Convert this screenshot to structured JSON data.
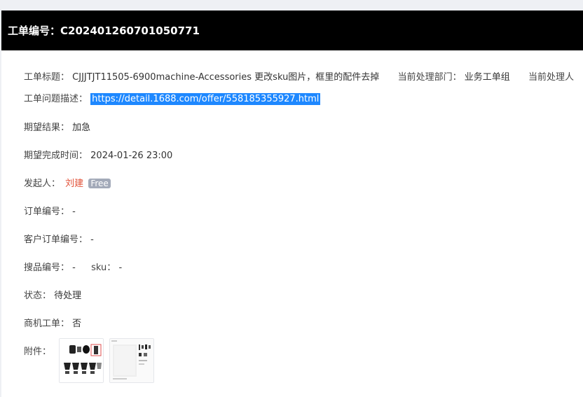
{
  "header": {
    "title": "工单编号：C202401260701050771"
  },
  "fields": {
    "title_label": "工单标题：",
    "title_value": "CJJJTJT11505-6900machine-Accessories  更改sku图片，框里的配件去掉",
    "dept_label": "当前处理部门：",
    "dept_value": "业务工单组",
    "handler_label": "当前处理人",
    "desc_label": "工单问题描述：",
    "desc_link": "https://detail.1688.com/offer/558185355927.html",
    "expect_label": "期望结果：",
    "expect_value": "加急",
    "due_label": "期望完成时间：",
    "due_value": "2024-01-26 23:00",
    "initiator_label": "发起人：",
    "initiator_name": "刘建",
    "initiator_badge": "Free",
    "order_label": "订单编号：",
    "order_value": "-",
    "customer_order_label": "客户订单编号：",
    "customer_order_value": "-",
    "search_label": "搜品编号：",
    "search_value": "-",
    "sku_label": "sku：",
    "sku_value": "-",
    "status_label": "状态：",
    "status_value": "待处理",
    "biz_label": "商机工单：",
    "biz_value": "否",
    "attach_label": "附件："
  },
  "attachments": [
    {
      "name": "accessories-photo-thumbnail"
    },
    {
      "name": "product-listing-screenshot-thumbnail"
    }
  ],
  "colors": {
    "header_bg": "#000000",
    "link_highlight": "#1e88ff",
    "initiator_name": "#e2533a",
    "badge_bg": "#a3aab9"
  }
}
